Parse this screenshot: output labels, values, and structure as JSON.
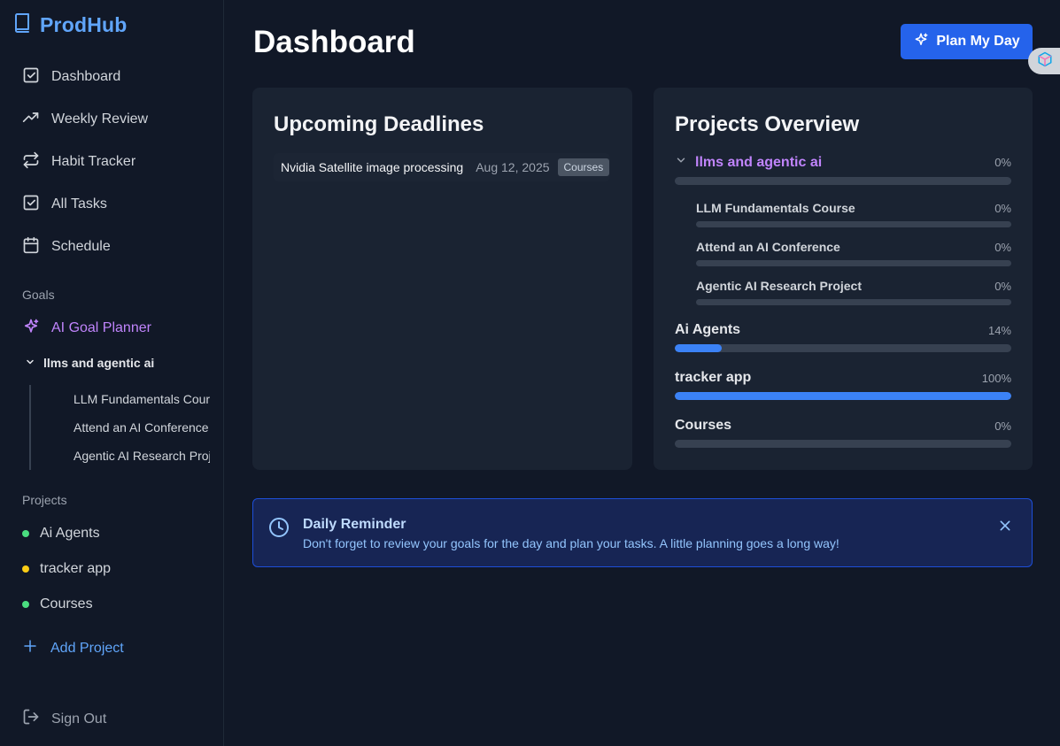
{
  "app": {
    "brand": "ProdHub"
  },
  "sidebar": {
    "nav": [
      {
        "label": "Dashboard",
        "icon": "check-square-icon"
      },
      {
        "label": "Weekly Review",
        "icon": "trending-up-icon"
      },
      {
        "label": "Habit Tracker",
        "icon": "repeat-icon"
      },
      {
        "label": "All Tasks",
        "icon": "check-square-icon"
      },
      {
        "label": "Schedule",
        "icon": "calendar-icon"
      }
    ],
    "goals_label": "Goals",
    "goal_planner_label": "AI Goal Planner",
    "goal_group": {
      "label": "llms and agentic ai",
      "children": [
        "LLM Fundamentals Course",
        "Attend an AI Conference",
        "Agentic AI Research Project"
      ]
    },
    "projects_label": "Projects",
    "projects": [
      {
        "label": "Ai Agents",
        "color": "#4ade80"
      },
      {
        "label": "tracker app",
        "color": "#facc15"
      },
      {
        "label": "Courses",
        "color": "#4ade80"
      }
    ],
    "add_project_label": "Add Project",
    "sign_out_label": "Sign Out"
  },
  "header": {
    "title": "Dashboard",
    "plan_button_label": "Plan My Day"
  },
  "deadlines": {
    "title": "Upcoming Deadlines",
    "items": [
      {
        "name": "Nvidia Satellite image processing",
        "date": "Aug 12, 2025",
        "tag": "Courses"
      }
    ]
  },
  "projects_overview": {
    "title": "Projects Overview",
    "goal": {
      "name": "llms and agentic ai",
      "percent_label": "0%",
      "progress": 0,
      "children": [
        {
          "name": "LLM Fundamentals Course",
          "percent_label": "0%",
          "progress": 0
        },
        {
          "name": "Attend an AI Conference",
          "percent_label": "0%",
          "progress": 0
        },
        {
          "name": "Agentic AI Research Project",
          "percent_label": "0%",
          "progress": 0
        }
      ]
    },
    "projects": [
      {
        "name": "Ai Agents",
        "percent_label": "14%",
        "progress": 14
      },
      {
        "name": "tracker app",
        "percent_label": "100%",
        "progress": 100
      },
      {
        "name": "Courses",
        "percent_label": "0%",
        "progress": 0
      }
    ]
  },
  "reminder": {
    "title": "Daily Reminder",
    "text": "Don't forget to review your goals for the day and plan your tasks. A little planning goes a long way!"
  }
}
